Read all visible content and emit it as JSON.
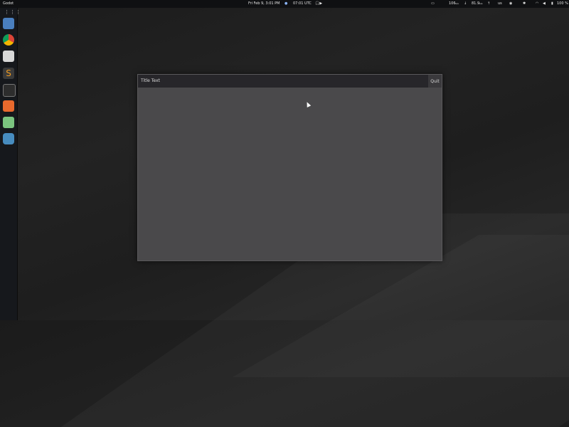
{
  "topbar": {
    "app_name": "Godot",
    "datetime": "Fri Feb 9, 3:01 PM",
    "utc_time": "07:01 UTC",
    "net_down": "106",
    "net_down_unit": "k/s",
    "net_up": "81.9",
    "net_up_unit": "k/s",
    "keyboard_layout": "us",
    "battery": "100 %"
  },
  "dock": {
    "items": [
      {
        "icon": "files-icon",
        "color": "#4a7fbf"
      },
      {
        "icon": "chrome-icon",
        "color": "#e0a12a"
      },
      {
        "icon": "calendar-icon",
        "color": "#cfcfcf"
      },
      {
        "icon": "sublime-text-icon",
        "color": "#f29c1f"
      },
      {
        "icon": "terminal-icon",
        "color": "#3b3b3b"
      },
      {
        "icon": "software-store-icon",
        "color": "#e8692d"
      },
      {
        "icon": "chat-icon",
        "color": "#6cc070"
      },
      {
        "icon": "godot-icon",
        "color": "#478cbf"
      }
    ]
  },
  "window": {
    "title": "Title Text",
    "quit_label": "Quit"
  }
}
